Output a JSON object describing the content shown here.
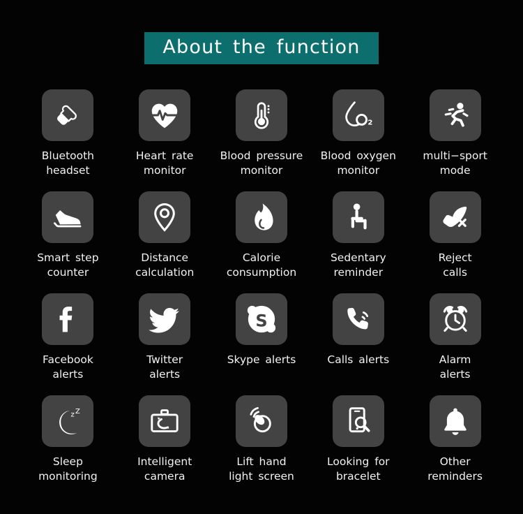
{
  "header": {
    "title": "About  the  function",
    "banner_color": "#0d6e6e"
  },
  "theme": {
    "background": "#030303",
    "tile_background": "#434343",
    "text_color": "#f2f2f2",
    "icon_color": "#ffffff"
  },
  "features": [
    {
      "icon": "bluetooth-headset-icon",
      "label": "Bluetooth\nheadset"
    },
    {
      "icon": "heart-rate-icon",
      "label": "Heart rate\nmonitor"
    },
    {
      "icon": "blood-pressure-icon",
      "label": "Blood pressure\nmonitor"
    },
    {
      "icon": "blood-oxygen-icon",
      "label": "Blood oxygen\nmonitor"
    },
    {
      "icon": "running-icon",
      "label": "multi−sport\nmode"
    },
    {
      "icon": "shoe-step-icon",
      "label": "Smart step\ncounter"
    },
    {
      "icon": "location-pin-icon",
      "label": "Distance\ncalculation"
    },
    {
      "icon": "flame-icon",
      "label": "Calorie\nconsumption"
    },
    {
      "icon": "sitting-person-icon",
      "label": "Sedentary\nreminder"
    },
    {
      "icon": "reject-call-icon",
      "label": "Reject\ncalls"
    },
    {
      "icon": "facebook-icon",
      "label": "Facebook\nalerts"
    },
    {
      "icon": "twitter-icon",
      "label": "Twitter\nalerts"
    },
    {
      "icon": "skype-icon",
      "label": "Skype alerts"
    },
    {
      "icon": "incoming-call-icon",
      "label": "Calls alerts"
    },
    {
      "icon": "alarm-clock-icon",
      "label": "Alarm\nalerts"
    },
    {
      "icon": "moon-sleep-icon",
      "label": "Sleep\nmonitoring"
    },
    {
      "icon": "camera-remote-icon",
      "label": "Intelligent\ncamera"
    },
    {
      "icon": "lift-hand-light-icon",
      "label": "Lift hand\nlight screen"
    },
    {
      "icon": "find-bracelet-icon",
      "label": "Looking for\nbracelet"
    },
    {
      "icon": "bell-icon",
      "label": "Other\nreminders"
    }
  ]
}
